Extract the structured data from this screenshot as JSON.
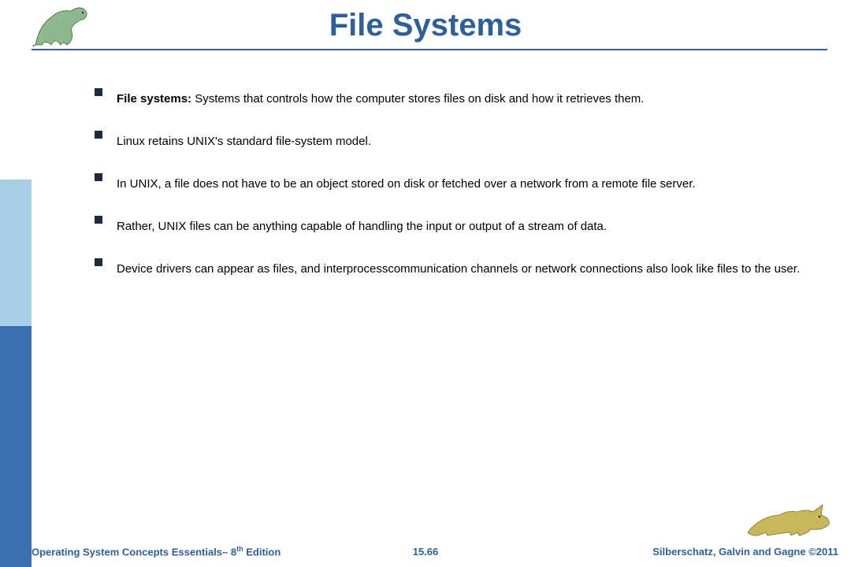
{
  "title": "File Systems",
  "bullets": [
    {
      "bold": "File systems:",
      "text": " Systems that controls how the computer stores files on disk and how it retrieves them."
    },
    {
      "bold": "",
      "text": "Linux retains UNIX's standard file-system model."
    },
    {
      "bold": "",
      "text": "In UNIX, a file does not have to be an object stored on disk or fetched over a network from a remote file server."
    },
    {
      "bold": "",
      "text": "Rather, UNIX files can be anything capable of handling the input or output of a stream of data."
    },
    {
      "bold": "",
      "text": "Device drivers can appear as files, and interprocesscommunication channels or network connections also look like files to the user."
    }
  ],
  "footer": {
    "left_pre": "Operating System Concepts Essentials– 8",
    "left_sup": "th",
    "left_post": " Edition",
    "center": "15.66",
    "right": "Silberschatz, Galvin and Gagne ©2011"
  }
}
